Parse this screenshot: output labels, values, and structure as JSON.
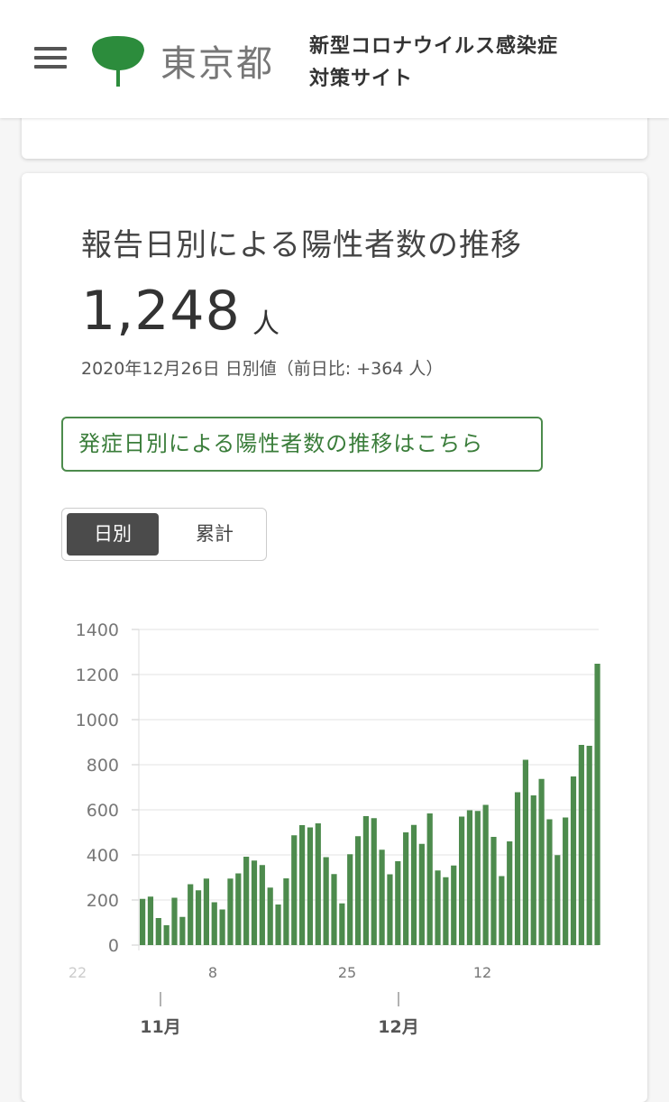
{
  "header": {
    "logo_text": "東京都",
    "site_title_line1": "新型コロナウイルス感染症",
    "site_title_line2": "対策サイト",
    "brand_color": "#2c8c3c"
  },
  "card": {
    "title": "報告日別による陽性者数の推移",
    "big_number": "1,248",
    "unit": "人",
    "date_line": "2020年12月26日 日別値（前日比: +364 人）",
    "link_label": "発症日別による陽性者数の推移はこちら",
    "toggle": {
      "daily": "日別",
      "cumulative": "累計",
      "selected": "日別"
    }
  },
  "chart_data": {
    "type": "bar",
    "bar_color": "#4d8b4d",
    "ylim": [
      0,
      1400
    ],
    "y_ticks": [
      "1400",
      "1200",
      "1000",
      "800",
      "600",
      "400",
      "200",
      "0"
    ],
    "x_ticks": [
      "22",
      "8",
      "25",
      "12"
    ],
    "month_labels": [
      "11月",
      "12月"
    ],
    "values": [
      205,
      215,
      120,
      88,
      210,
      125,
      270,
      243,
      295,
      190,
      158,
      295,
      318,
      392,
      375,
      355,
      255,
      180,
      296,
      487,
      532,
      522,
      540,
      390,
      315,
      185,
      403,
      483,
      572,
      563,
      423,
      314,
      372,
      500,
      533,
      449,
      584,
      331,
      301,
      353,
      570,
      598,
      595,
      622,
      480,
      306,
      460,
      678,
      822,
      664,
      737,
      558,
      399,
      566,
      748,
      888,
      884,
      1248
    ]
  }
}
